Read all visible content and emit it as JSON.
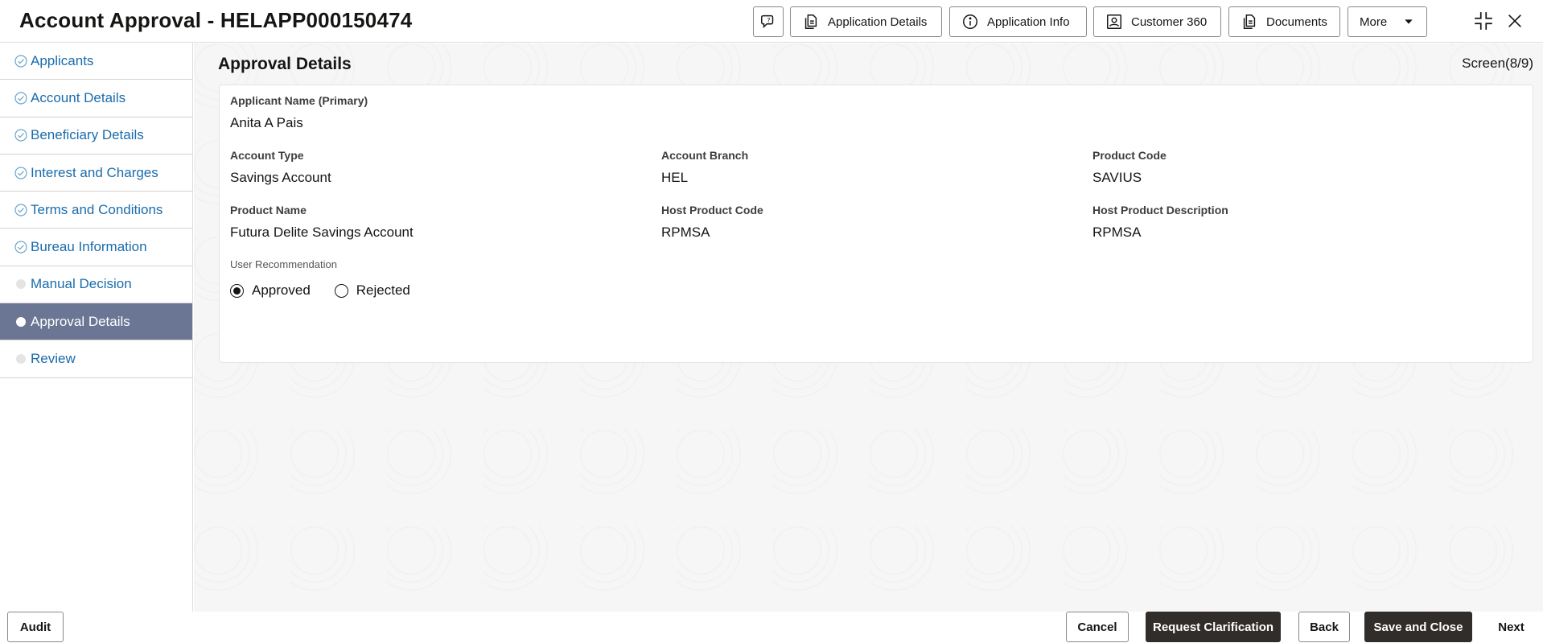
{
  "header": {
    "title": "Account Approval - HELAPP000150474",
    "buttons": {
      "help_icon": "chat-help-icon",
      "application_details": "Application Details",
      "application_info": "Application Info",
      "customer_360": "Customer 360",
      "documents": "Documents",
      "more": "More"
    }
  },
  "sidebar": {
    "items": [
      {
        "label": "Applicants",
        "state": "completed"
      },
      {
        "label": "Account Details",
        "state": "completed"
      },
      {
        "label": "Beneficiary Details",
        "state": "completed"
      },
      {
        "label": "Interest and Charges",
        "state": "completed"
      },
      {
        "label": "Terms and Conditions",
        "state": "completed"
      },
      {
        "label": "Bureau Information",
        "state": "completed"
      },
      {
        "label": "Manual Decision",
        "state": "pending"
      },
      {
        "label": "Approval Details",
        "state": "active"
      },
      {
        "label": "Review",
        "state": "pending"
      }
    ]
  },
  "main": {
    "title": "Approval Details",
    "screen": "Screen(8/9)",
    "fields": {
      "applicant_name": {
        "label": "Applicant Name (Primary)",
        "value": "Anita A Pais"
      },
      "account_type": {
        "label": "Account Type",
        "value": "Savings Account"
      },
      "account_branch": {
        "label": "Account Branch",
        "value": "HEL"
      },
      "product_code": {
        "label": "Product Code",
        "value": "SAVIUS"
      },
      "product_name": {
        "label": "Product Name",
        "value": "Futura Delite Savings Account"
      },
      "host_product_code": {
        "label": "Host Product Code",
        "value": "RPMSA"
      },
      "host_product_description": {
        "label": "Host Product Description",
        "value": "RPMSA"
      }
    },
    "user_recommendation": {
      "label": "User Recommendation",
      "options": [
        "Approved",
        "Rejected"
      ],
      "selected": "Approved"
    }
  },
  "footer": {
    "audit": "Audit",
    "cancel": "Cancel",
    "request_clarification": "Request Clarification",
    "back": "Back",
    "save_and_close": "Save and Close",
    "next": "Next"
  },
  "colors": {
    "accent_link": "#1a6cab",
    "active_nav": "#6b7695",
    "dark_button": "#312d2a"
  }
}
